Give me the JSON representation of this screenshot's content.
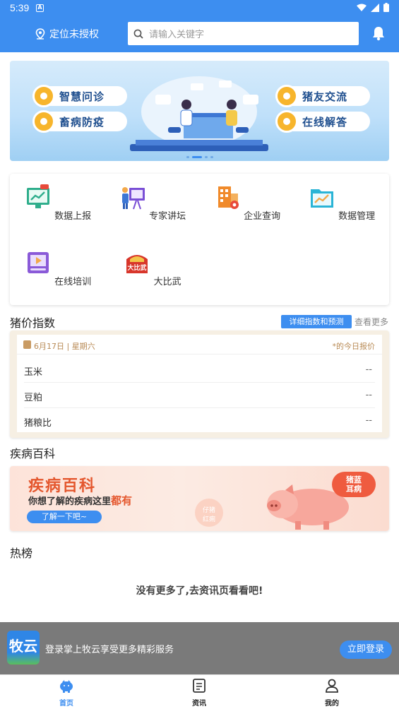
{
  "status_bar": {
    "time": "5:39"
  },
  "header": {
    "location_label": "定位未授权",
    "search_placeholder": "请输入关键字"
  },
  "banner": {
    "pills": [
      "智慧问诊",
      "畜病防疫",
      "猪友交流",
      "在线解答"
    ]
  },
  "grid": {
    "items": [
      {
        "label": "数据上报",
        "icon": "data-report-icon"
      },
      {
        "label": "专家讲坛",
        "icon": "expert-lecture-icon"
      },
      {
        "label": "企业查询",
        "icon": "company-query-icon"
      },
      {
        "label": "数据管理",
        "icon": "data-management-icon"
      },
      {
        "label": "在线培训",
        "icon": "online-training-icon"
      },
      {
        "label": "大比武",
        "icon": "competition-icon"
      }
    ],
    "competition_badge": "大比武"
  },
  "pig_price": {
    "title": "猪价指数",
    "detail_button": "详细指数和预测",
    "more_link": "查看更多",
    "date": "6月17日 | 星期六",
    "note": "*的今日报价",
    "rows": [
      {
        "name": "玉米",
        "value": "--"
      },
      {
        "name": "豆粕",
        "value": "--"
      },
      {
        "name": "猪粮比",
        "value": "--"
      }
    ]
  },
  "disease": {
    "title": "疾病百科",
    "banner_title": "疾病百科",
    "banner_sub_prefix": "你想了解的疾病这里",
    "banner_sub_emph": "都有",
    "banner_button": "了解一下吧~",
    "ribbon": "猪蓝\n耳病",
    "tag": "仔猪\n红痢"
  },
  "hot": {
    "title": "热榜",
    "empty_message": "没有更多了,去资讯页看看吧!"
  },
  "login_bar": {
    "logo_text": "牧云",
    "text": "登录掌上牧云享受更多精彩服务",
    "button": "立即登录"
  },
  "nav": {
    "items": [
      {
        "label": "首页",
        "active": true
      },
      {
        "label": "资讯",
        "active": false
      },
      {
        "label": "我的",
        "active": false
      }
    ]
  },
  "colors": {
    "primary": "#3d8ef0",
    "accent": "#e4572e"
  }
}
